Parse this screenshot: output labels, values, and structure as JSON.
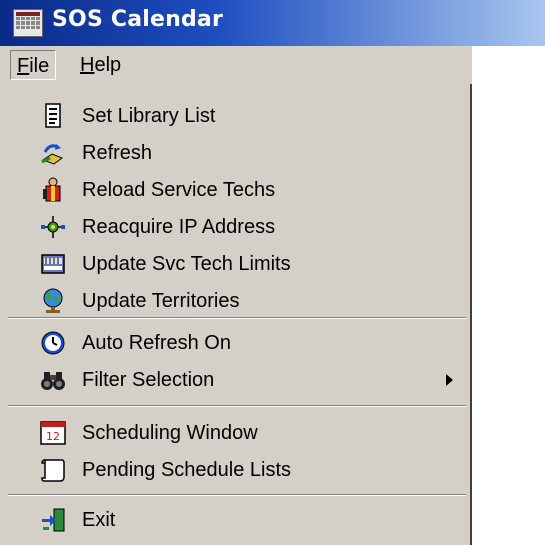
{
  "window": {
    "title": "SOS Calendar",
    "app_icon": "calendar-grid-icon"
  },
  "menubar": {
    "file": {
      "label": "File",
      "mnemonic": "F",
      "rest": "ile"
    },
    "help": {
      "label": "Help",
      "mnemonic": "H",
      "rest": "elp"
    }
  },
  "file_menu": {
    "items": [
      {
        "label": "Set Library List",
        "icon": "document-list-icon"
      },
      {
        "label": "Refresh",
        "icon": "refresh-icon"
      },
      {
        "label": "Reload Service Techs",
        "icon": "service-techs-icon"
      },
      {
        "label": "Reacquire IP Address",
        "icon": "network-icon"
      },
      {
        "label": "Update Svc Tech Limits",
        "icon": "limits-icon"
      },
      {
        "label": "Update Territories",
        "icon": "globe-icon"
      },
      {
        "label": "Auto Refresh On",
        "icon": "clock-icon"
      },
      {
        "label": "Filter Selection",
        "icon": "binoculars-icon",
        "submenu": true
      },
      {
        "label": "Scheduling Window",
        "icon": "calendar-icon"
      },
      {
        "label": "Pending Schedule Lists",
        "icon": "scroll-icon"
      },
      {
        "label": "Exit",
        "icon": "exit-icon"
      }
    ]
  },
  "colors": {
    "titlebar_start": "#0a2a88",
    "titlebar_end": "#a9c6ee",
    "menu_face": "#d4d0c8"
  }
}
